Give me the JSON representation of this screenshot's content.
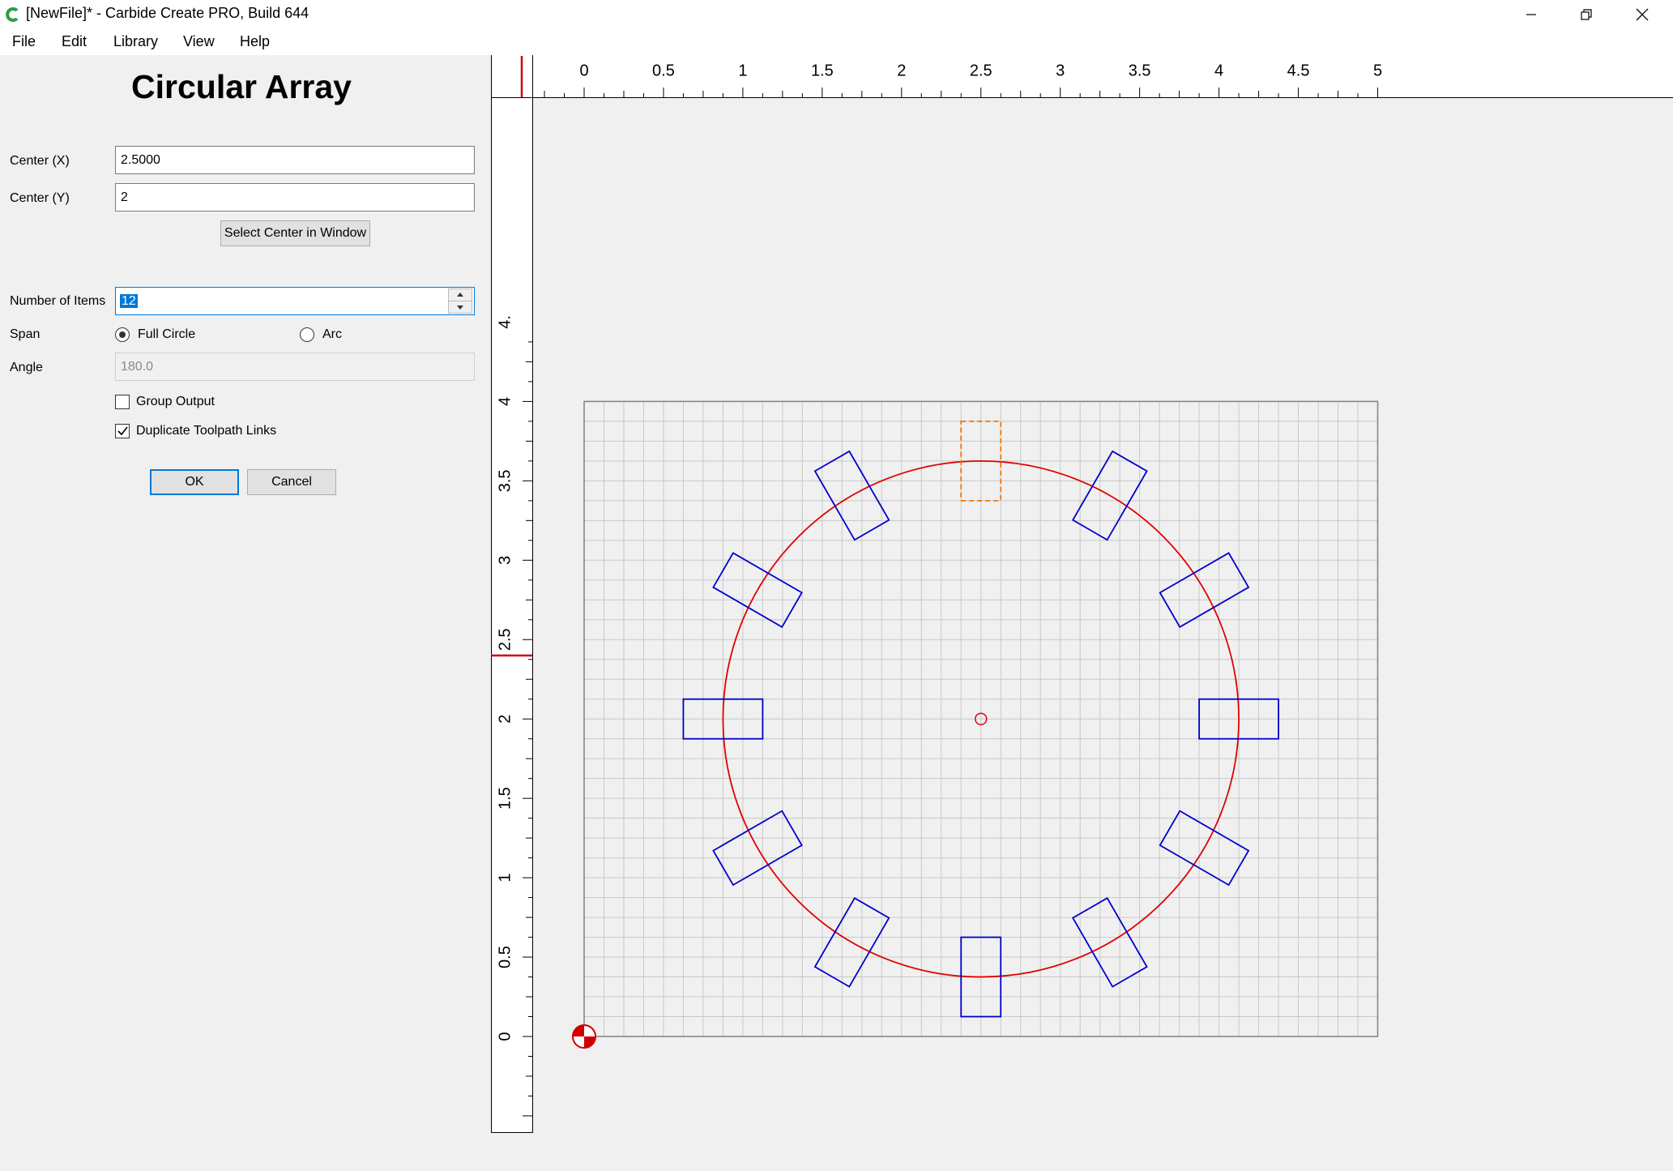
{
  "window": {
    "title": "[NewFile]* - Carbide Create PRO, Build 644",
    "icons": [
      "carbide-logo-icon",
      "minimize-icon",
      "restore-icon",
      "close-icon"
    ]
  },
  "menu": {
    "items": [
      "File",
      "Edit",
      "Library",
      "View",
      "Help"
    ]
  },
  "dialog": {
    "title": "Circular Array",
    "center_x_label": "Center (X)",
    "center_x_value": "2.5000",
    "center_y_label": "Center (Y)",
    "center_y_value": "2",
    "select_center_label": "Select Center in Window",
    "number_items_label": "Number of Items",
    "number_items_value": "12",
    "span_label": "Span",
    "span_options": [
      "Full Circle",
      "Arc"
    ],
    "span_selected": "Full Circle",
    "angle_label": "Angle",
    "angle_value": "180.0",
    "group_output_label": "Group Output",
    "group_output_checked": false,
    "duplicate_links_label": "Duplicate Toolpath Links",
    "duplicate_links_checked": true,
    "ok_label": "OK",
    "cancel_label": "Cancel"
  },
  "canvas": {
    "x_ruler_labels": [
      "0",
      "0.5",
      "1",
      "1.5",
      "2",
      "2.5",
      "3",
      "3.5",
      "4",
      "4.5",
      "5"
    ],
    "y_ruler_labels": [
      "0",
      "0.5",
      "1",
      "1.5",
      "2",
      "2.5",
      "3",
      "3.5",
      "4",
      "4."
    ],
    "stock": {
      "width": 5,
      "height": 4,
      "grid_step": 0.125
    },
    "array_center": [
      2.5,
      2
    ],
    "circle_radius": 1.625,
    "item_count": 12,
    "item_size": [
      0.5,
      0.25
    ],
    "original_item": {
      "center": [
        2.5,
        3.625
      ],
      "style": "dashed"
    },
    "cursor_marker": {
      "x": 0,
      "y": 2.4
    },
    "colors": {
      "grid": "#c8c8c8",
      "circle": "#e00000",
      "items": "#0000cc",
      "original": "#ee7700",
      "marker": "#d00000"
    }
  }
}
